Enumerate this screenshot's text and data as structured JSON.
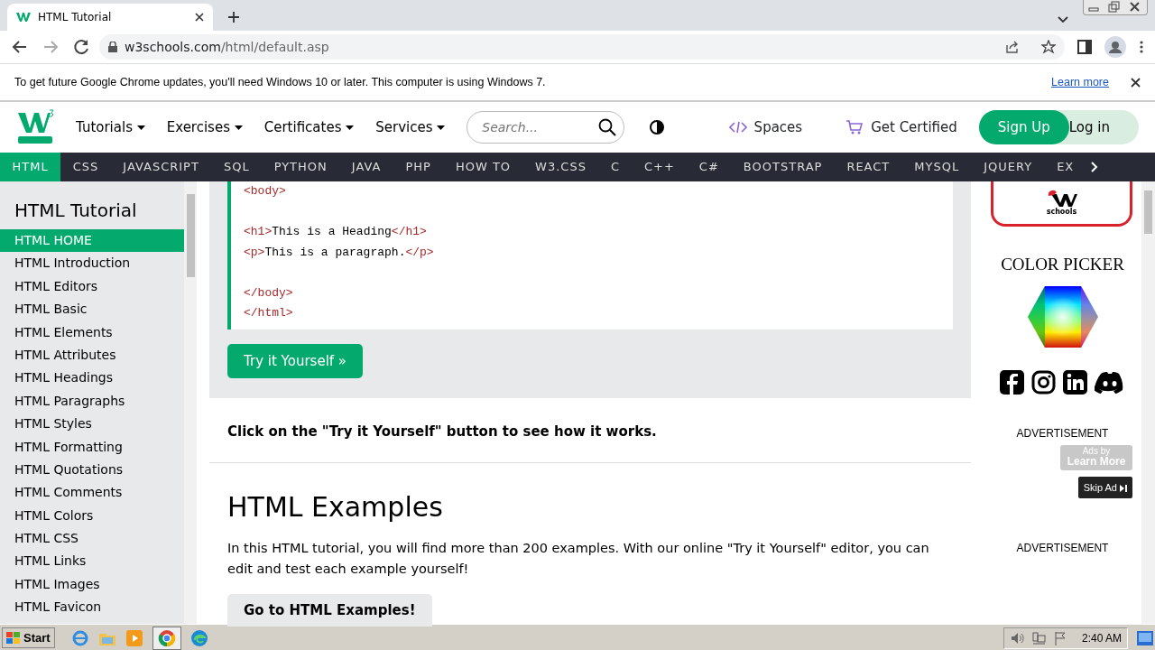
{
  "browser": {
    "tab_title": "HTML Tutorial",
    "address_host": "w3schools.com",
    "address_path": "/html/default.asp"
  },
  "infobar": {
    "message": "To get future Google Chrome updates, you'll need Windows 10 or later. This computer is using Windows 7.",
    "link": "Learn more"
  },
  "header": {
    "menus": [
      "Tutorials",
      "Exercises",
      "Certificates",
      "Services"
    ],
    "search": {
      "placeholder": "Search..."
    },
    "spaces": "Spaces",
    "get_certified": "Get Certified",
    "sign_up": "Sign Up",
    "log_in": "Log in"
  },
  "topnav": [
    {
      "label": "HTML",
      "selected": true
    },
    {
      "label": "CSS",
      "selected": false
    },
    {
      "label": "JAVASCRIPT",
      "selected": false
    },
    {
      "label": "SQL",
      "selected": false
    },
    {
      "label": "PYTHON",
      "selected": false
    },
    {
      "label": "JAVA",
      "selected": false
    },
    {
      "label": "PHP",
      "selected": false
    },
    {
      "label": "HOW TO",
      "selected": false
    },
    {
      "label": "W3.CSS",
      "selected": false
    },
    {
      "label": "C",
      "selected": false
    },
    {
      "label": "C++",
      "selected": false
    },
    {
      "label": "C#",
      "selected": false
    },
    {
      "label": "BOOTSTRAP",
      "selected": false
    },
    {
      "label": "REACT",
      "selected": false
    },
    {
      "label": "MYSQL",
      "selected": false
    },
    {
      "label": "JQUERY",
      "selected": false
    },
    {
      "label": "EX",
      "selected": false
    }
  ],
  "sidebar": {
    "title": "HTML Tutorial",
    "items": [
      {
        "label": "HTML HOME",
        "selected": true
      },
      {
        "label": "HTML Introduction",
        "selected": false
      },
      {
        "label": "HTML Editors",
        "selected": false
      },
      {
        "label": "HTML Basic",
        "selected": false
      },
      {
        "label": "HTML Elements",
        "selected": false
      },
      {
        "label": "HTML Attributes",
        "selected": false
      },
      {
        "label": "HTML Headings",
        "selected": false
      },
      {
        "label": "HTML Paragraphs",
        "selected": false
      },
      {
        "label": "HTML Styles",
        "selected": false
      },
      {
        "label": "HTML Formatting",
        "selected": false
      },
      {
        "label": "HTML Quotations",
        "selected": false
      },
      {
        "label": "HTML Comments",
        "selected": false
      },
      {
        "label": "HTML Colors",
        "selected": false
      },
      {
        "label": "HTML CSS",
        "selected": false
      },
      {
        "label": "HTML Links",
        "selected": false
      },
      {
        "label": "HTML Images",
        "selected": false
      },
      {
        "label": "HTML Favicon",
        "selected": false
      }
    ]
  },
  "content": {
    "code_lines": [
      {
        "kind": "code",
        "segments": [
          {
            "kind": "tag",
            "text": "<body>"
          }
        ]
      },
      {
        "kind": "blank"
      },
      {
        "kind": "code",
        "segments": [
          {
            "kind": "tag",
            "text": "<h1>"
          },
          {
            "kind": "text",
            "text": "This is a Heading"
          },
          {
            "kind": "tag",
            "text": "</h1>"
          }
        ]
      },
      {
        "kind": "code",
        "segments": [
          {
            "kind": "tag",
            "text": "<p>"
          },
          {
            "kind": "text",
            "text": "This is a paragraph."
          },
          {
            "kind": "tag",
            "text": "</p>"
          }
        ]
      },
      {
        "kind": "blank"
      },
      {
        "kind": "code",
        "segments": [
          {
            "kind": "tag",
            "text": "</body>"
          }
        ]
      },
      {
        "kind": "code",
        "segments": [
          {
            "kind": "tag",
            "text": "</html>"
          }
        ]
      }
    ],
    "try_button": "Try it Yourself »",
    "note": "Click on the \"Try it Yourself\" button to see how it works.",
    "heading": "HTML Examples",
    "paragraph": "In this HTML tutorial, you will find more than 200 examples. With our online \"Try it Yourself\" editor, you can edit and test each example yourself!",
    "examples_button": "Go to HTML Examples!"
  },
  "right": {
    "logo_sub": "schools",
    "color_picker": "COLOR PICKER",
    "ad_label": "ADVERTISEMENT",
    "ads_by": "Ads by",
    "learn_more": "Learn More",
    "skip_ad": "Skip Ad",
    "ad_label_2": "ADVERTISEMENT"
  },
  "taskbar": {
    "start": "Start",
    "clock": "2:40 AM"
  }
}
